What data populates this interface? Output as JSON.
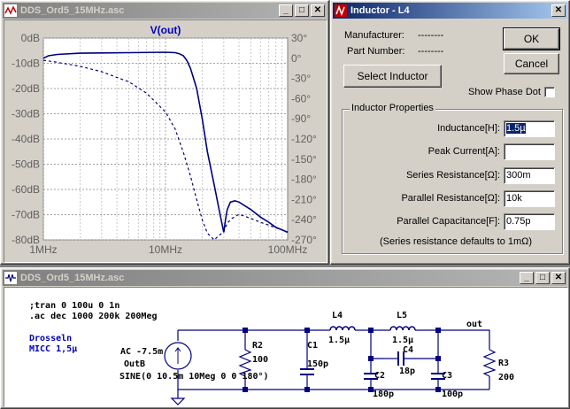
{
  "plot_window": {
    "title": "DDS_Ord5_15MHz.asc",
    "trace_label": "V(out)",
    "left_ticks": [
      "0dB",
      "-10dB",
      "-20dB",
      "-30dB",
      "-40dB",
      "-50dB",
      "-60dB",
      "-70dB",
      "-80dB"
    ],
    "right_ticks": [
      "30°",
      "0°",
      "-30°",
      "-60°",
      "-90°",
      "-120°",
      "-150°",
      "-180°",
      "-210°",
      "-240°",
      "-270°"
    ],
    "x_ticks": [
      "1MHz",
      "10MHz",
      "100MHz"
    ]
  },
  "chart_data": {
    "type": "line",
    "xscale": "log",
    "xlim": [
      1000000,
      100000000
    ],
    "ylim": [
      -80,
      0
    ],
    "y2lim": [
      -270,
      30
    ],
    "grid": true,
    "series": [
      {
        "name": "V(out)",
        "style": "solid",
        "axis": "left",
        "x": [
          1000000,
          1100000,
          1300000,
          2000000,
          5000000,
          10000000,
          12000000,
          13000000,
          14000000,
          15000000,
          16000000,
          18000000,
          20000000,
          22000000,
          25000000,
          28000000,
          30000000,
          31000000,
          32000000,
          34000000,
          37000000,
          40000000,
          50000000,
          60000000,
          70000000,
          80000000,
          90000000,
          100000000
        ],
        "y": [
          -8,
          -7,
          -6.5,
          -6,
          -5.8,
          -5.6,
          -5.8,
          -6.2,
          -7,
          -9,
          -12,
          -20,
          -32,
          -45,
          -58,
          -70,
          -77,
          -72,
          -68,
          -65,
          -64.5,
          -65,
          -68,
          -71,
          -73,
          -75,
          -76,
          -77
        ]
      },
      {
        "name": "phase",
        "style": "dashed",
        "axis": "right",
        "x": [
          1000000,
          1200000,
          1500000,
          2000000,
          3000000,
          5000000,
          7000000,
          10000000,
          12000000,
          14000000,
          16000000,
          18000000,
          20000000,
          22000000,
          25000000,
          28000000,
          30000000,
          32000000,
          35000000,
          40000000,
          50000000,
          60000000,
          70000000,
          80000000,
          90000000,
          100000000
        ],
        "y": [
          -3,
          -5,
          -8,
          -12,
          -20,
          -35,
          -52,
          -80,
          -105,
          -140,
          -175,
          -210,
          -240,
          -260,
          -270,
          -262,
          -258,
          -245,
          -238,
          -232,
          -238,
          -244,
          -248,
          -252,
          -255,
          -258
        ]
      }
    ]
  },
  "dialog": {
    "title": "Inductor - L4",
    "manufacturer_label": "Manufacturer:",
    "manufacturer_value": "--------",
    "part_number_label": "Part Number:",
    "part_number_value": "--------",
    "ok_label": "OK",
    "cancel_label": "Cancel",
    "select_inductor_label": "Select Inductor",
    "show_phase_dot_label": "Show Phase Dot",
    "properties_group": "Inductor Properties",
    "inductance_label": "Inductance[H]:",
    "inductance_value": "1.5µ",
    "peak_current_label": "Peak Current[A]:",
    "peak_current_value": "",
    "series_resistance_label": "Series Resistance[Ω]:",
    "series_resistance_value": "300m",
    "parallel_resistance_label": "Parallel Resistance[Ω]:",
    "parallel_resistance_value": "10k",
    "parallel_capacitance_label": "Parallel Capacitance[F]:",
    "parallel_capacitance_value": "0.75p",
    "note": "(Series resistance defaults to 1mΩ)"
  },
  "schematic_window": {
    "title": "DDS_Ord5_15MHz.asc",
    "directive1": ";tran 0 100u 0 1n",
    "directive2": ".ac dec 1000 200k 200Meg",
    "comment1": "Drosseln",
    "comment2": "MICC 1,5µ",
    "source_value": "AC -7.5m",
    "source_name": "OutB",
    "source_sine": "SINE(0 10.5m 10Meg 0 0 180°)",
    "r2_name": "R2",
    "r2_value": "100",
    "c1_name": "C1",
    "c1_value": "150p",
    "l4_name": "L4",
    "l4_value": "1.5µ",
    "l5_name": "L5",
    "l5_value": "1.5µ",
    "c4_name": "C4",
    "c4_value": "18p",
    "c2_name": "C2",
    "c2_value": "180p",
    "c3_name": "C3",
    "c3_value": "100p",
    "r3_name": "R3",
    "r3_value": "200",
    "out_label": "out"
  },
  "colors": {
    "trace": "#00007f",
    "plot_bg": "#ffffff",
    "axis_text": "#0000c0",
    "title_active": "#0a246a",
    "schem_comment": "#0000c0"
  }
}
